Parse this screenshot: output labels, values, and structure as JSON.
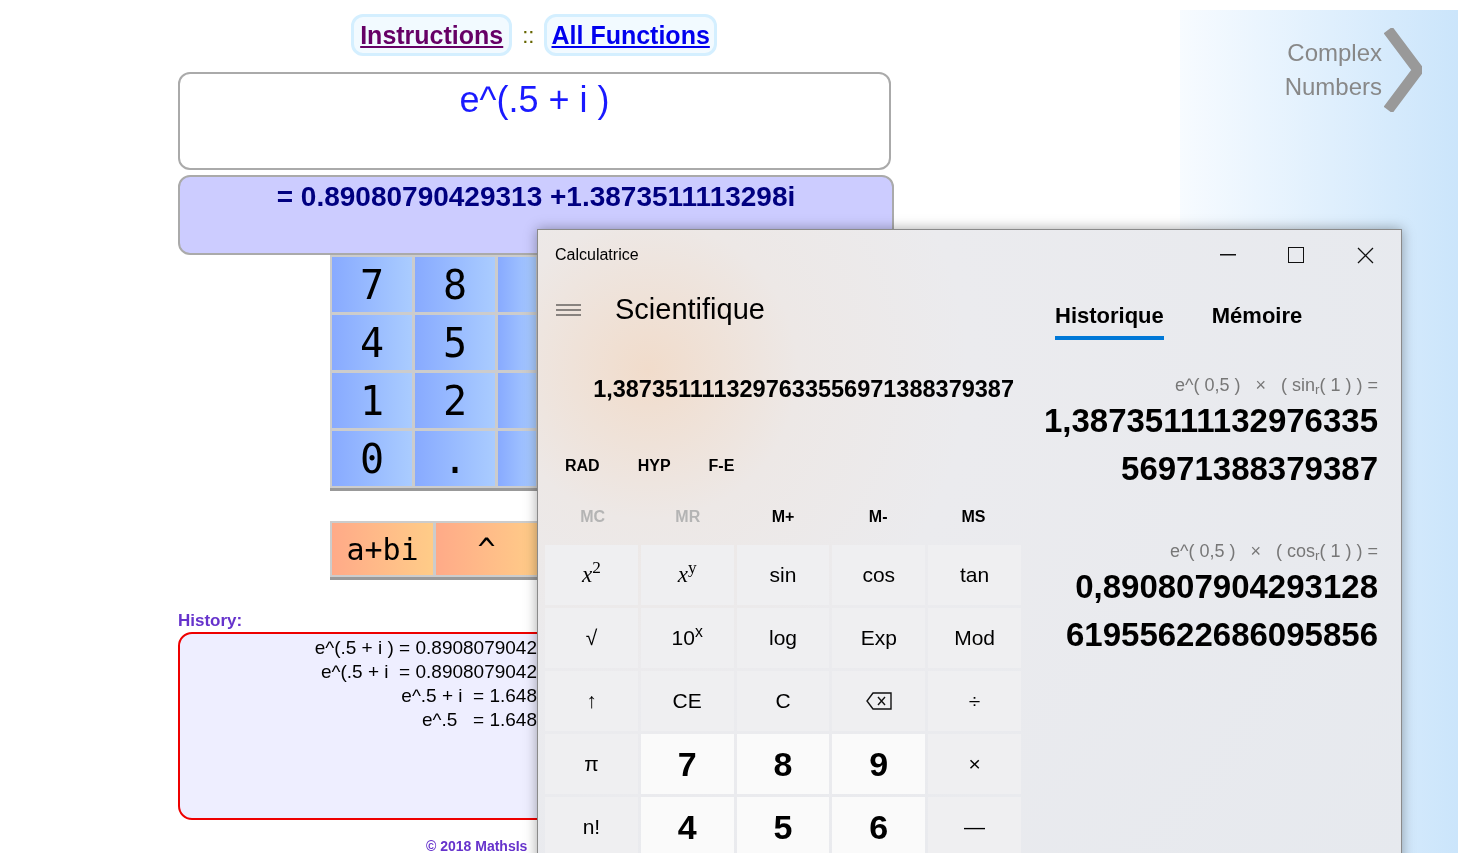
{
  "page": {
    "links": [
      {
        "label": "Instructions",
        "visited": true
      },
      {
        "label": "All Functions",
        "visited": false
      }
    ],
    "separator": "::",
    "expression": "e^(.5 + i )",
    "result": "= 0.89080790429313 +1.3873511113298i",
    "keypad": [
      [
        "7",
        "8"
      ],
      [
        "4",
        "5"
      ],
      [
        "1",
        "2"
      ],
      [
        "0",
        "."
      ]
    ],
    "operators": [
      "a+bi",
      "^"
    ],
    "history_label": "History:",
    "history": [
      "e^(.5 + i ) = 0.8908079042",
      "e^(.5 + i  = 0.8908079042",
      "e^.5 + i  = 1.648",
      "e^.5   = 1.648"
    ],
    "footer": "© 2018 MathsIs"
  },
  "side_link": {
    "lines": [
      "Complex",
      "Numbers"
    ]
  },
  "calculator": {
    "title": "Calculatrice",
    "mode": "Scientifique",
    "display": "1,3873511113297633556971388379387",
    "toggles": [
      "RAD",
      "HYP",
      "F-E"
    ],
    "memory": [
      {
        "label": "MC",
        "disabled": true
      },
      {
        "label": "MR",
        "disabled": true
      },
      {
        "label": "M+",
        "disabled": false
      },
      {
        "label": "M-",
        "disabled": false
      },
      {
        "label": "MS",
        "disabled": false
      }
    ],
    "keys": [
      {
        "label": "*x*$^{2}$",
        "kind": "math"
      },
      {
        "label": "*x*$^{y}$",
        "kind": "math"
      },
      {
        "label": "sin",
        "kind": "function"
      },
      {
        "label": "cos",
        "kind": "function"
      },
      {
        "label": "tan",
        "kind": "function"
      },
      {
        "label": "√",
        "kind": "function"
      },
      {
        "label": "10$^{x}$",
        "kind": "function"
      },
      {
        "label": "log",
        "kind": "function"
      },
      {
        "label": "Exp",
        "kind": "function"
      },
      {
        "label": "Mod",
        "kind": "function"
      },
      {
        "label": "↑",
        "kind": "function"
      },
      {
        "label": "CE",
        "kind": "function"
      },
      {
        "label": "C",
        "kind": "function"
      },
      {
        "kind": "backspace"
      },
      {
        "label": "÷",
        "kind": "function"
      },
      {
        "label": "π",
        "kind": "function"
      },
      {
        "label": "7",
        "kind": "digit"
      },
      {
        "label": "8",
        "kind": "digit"
      },
      {
        "label": "9",
        "kind": "digit"
      },
      {
        "label": "×",
        "kind": "function"
      },
      {
        "label": "n!",
        "kind": "function"
      },
      {
        "label": "4",
        "kind": "digit"
      },
      {
        "label": "5",
        "kind": "digit"
      },
      {
        "label": "6",
        "kind": "digit"
      },
      {
        "label": "—",
        "kind": "function"
      }
    ],
    "tabs": [
      {
        "label": "Historique",
        "selected": true
      },
      {
        "label": "Mémoire",
        "selected": false
      }
    ],
    "history": [
      {
        "expression": "e^( 0,5 )   ×   ( sin$_{r}$( 1 ) ) =",
        "result_lines": [
          "1,38735111132976335",
          "56971388379387"
        ]
      },
      {
        "expression": "e^( 0,5 )   ×   ( cos$_{r}$( 1 ) ) =",
        "result_lines": [
          "0,890807904293128",
          "61955622686095856"
        ]
      }
    ]
  }
}
